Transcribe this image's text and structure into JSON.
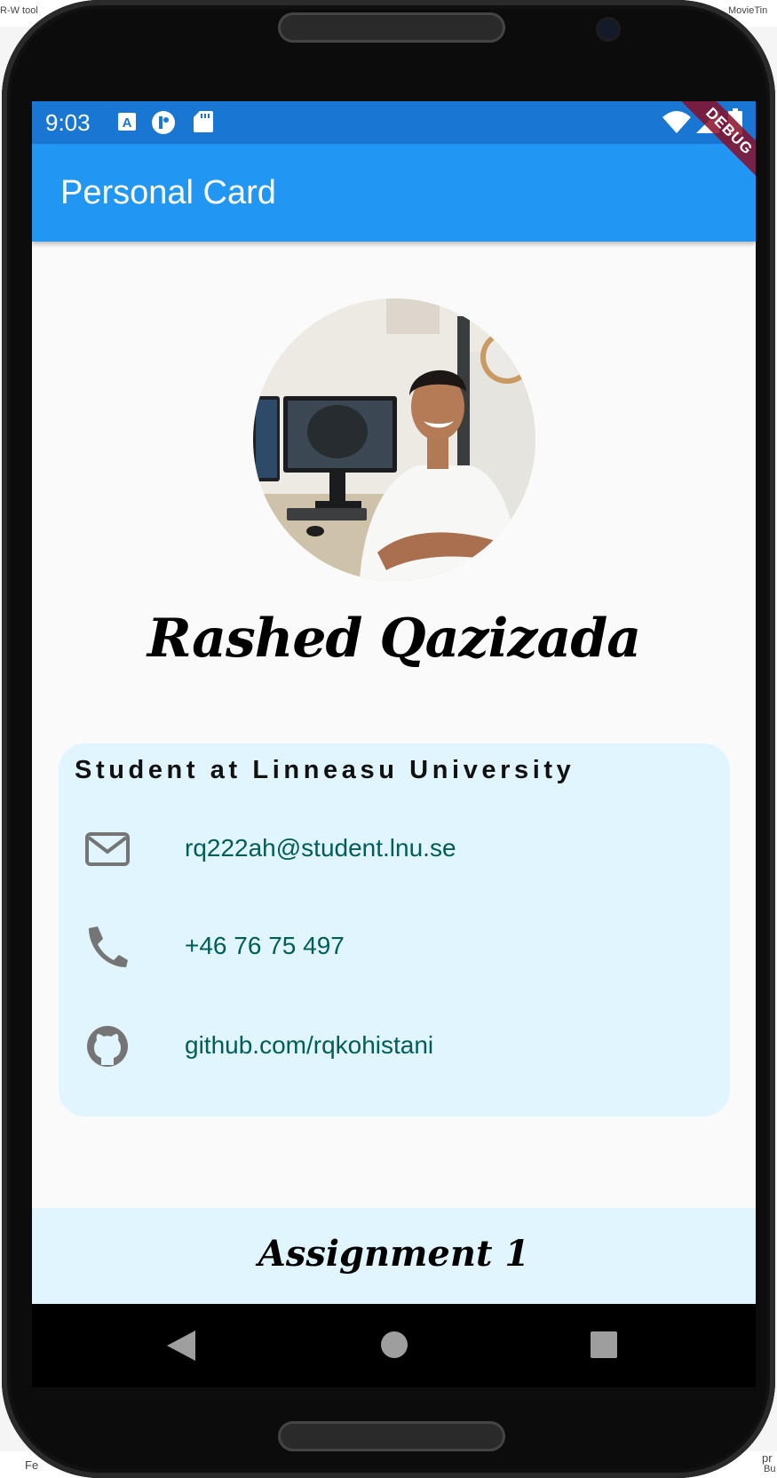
{
  "desktop": {
    "top_left_fragment": "R-W tool",
    "top_right_fragment": "MovieTin",
    "bottom_left_fragment": "Fe",
    "bottom_right_fragment_1": "pr",
    "bottom_right_fragment_2": "Bu"
  },
  "status_bar": {
    "time": "9:03",
    "icons": [
      "a-notification-icon",
      "accessibility-icon",
      "sd-card-icon",
      "wifi-icon",
      "signal-icon",
      "battery-icon"
    ]
  },
  "debug_banner": "DEBUG",
  "app_bar": {
    "title": "Personal Card"
  },
  "profile": {
    "name": "Rashed Qazizada",
    "photo_alt": "profile-photo"
  },
  "card": {
    "subtitle": "Student at Linneasu University",
    "contacts": [
      {
        "icon": "envelope-icon",
        "text": "rq222ah@student.lnu.se"
      },
      {
        "icon": "phone-icon",
        "text": "+46 76 75 497"
      },
      {
        "icon": "github-icon",
        "text": "github.com/rqkohistani"
      }
    ]
  },
  "footer": {
    "label": "Assignment 1"
  },
  "nav": [
    "back-icon",
    "home-icon",
    "recents-icon"
  ],
  "colors": {
    "status_bar": "#1976d2",
    "app_bar": "#2196f3",
    "card_bg": "#e1f5fe",
    "contact_text": "#005d57",
    "icon_gray": "#757575"
  }
}
